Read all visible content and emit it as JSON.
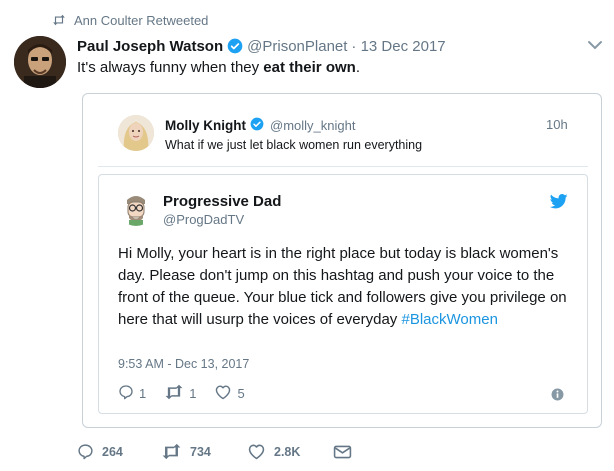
{
  "retweet": {
    "label": "Ann Coulter Retweeted"
  },
  "main_tweet": {
    "name": "Paul Joseph Watson",
    "handle": "@PrisonPlanet",
    "date": "· 13 Dec 2017",
    "text_before": "It's always funny when they ",
    "text_bold": "eat their own",
    "text_after": "."
  },
  "quoted_tweet": {
    "name": "Molly Knight",
    "handle": "@molly_knight",
    "time": "10h",
    "text": "What if we just let black women run everything"
  },
  "embedded_tweet": {
    "name": "Progressive Dad",
    "handle": "@ProgDadTV",
    "body": "Hi Molly, your heart is in the right place but today is black women's day. Please don't jump on this hashtag and push your voice to the front of the queue. Your blue tick and followers give you privilege on here that will usurp the voices of everyday ",
    "hashtag": "#BlackWomen",
    "timestamp": "9:53 AM - Dec 13, 2017",
    "replies": "1",
    "retweets": "1",
    "likes": "5"
  },
  "actions": {
    "replies": "264",
    "retweets": "734",
    "likes": "2.8K"
  },
  "colors": {
    "accent": "#1da1f2",
    "verified": "#1da1f2",
    "hashtag": "#1b95e0",
    "muted": "#657786"
  },
  "icons": [
    "retweet-icon",
    "verified-icon",
    "chevron-down-icon",
    "twitter-bird-icon",
    "reply-icon",
    "heart-icon",
    "info-icon",
    "message-icon"
  ]
}
